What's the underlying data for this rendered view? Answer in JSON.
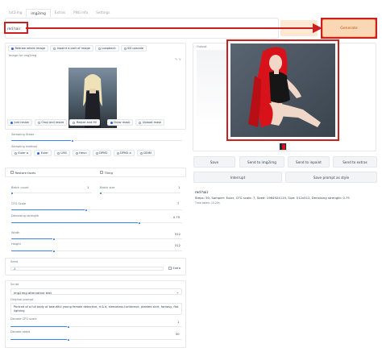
{
  "tabs": [
    "txt2img",
    "img2img",
    "Extras",
    "PNG Info",
    "Settings"
  ],
  "prompt": {
    "value": "red hair"
  },
  "generate_label": "Generate",
  "mode_tabs": [
    "Redraw whole image",
    "Inpaint a part of image",
    "Loopback",
    "SD upscale"
  ],
  "image_panel_label": "Image for img2img",
  "output_label": "Output",
  "resize_options": [
    "Just resize",
    "Crop and resize",
    "Resize and fill"
  ],
  "mask_options": [
    "Draw mask",
    "Upload mask"
  ],
  "sampling_steps": {
    "label": "Sampling Steps",
    "fraction": 0.36
  },
  "sampling_method": {
    "label": "Sampling method",
    "options": [
      "Euler a",
      "Euler",
      "LMS",
      "Heun",
      "DPM2",
      "DPM2 a",
      "DDIM"
    ],
    "selected": "Euler"
  },
  "restore_faces": "Restore faces",
  "tiling": "Tiling",
  "batch_count": {
    "label": "Batch count",
    "value": "1"
  },
  "batch_size": {
    "label": "Batch size",
    "value": "1"
  },
  "cfg_scale": {
    "label": "CFG Scale",
    "value": "7",
    "fraction": 0.44
  },
  "denoising": {
    "label": "Denoising strength",
    "value": "0.75",
    "fraction": 0.75
  },
  "width": {
    "label": "Width",
    "value": "512",
    "fraction": 0.25
  },
  "height": {
    "label": "Height",
    "value": "512",
    "fraction": 0.25
  },
  "seed": {
    "label": "Seed",
    "value": "-1"
  },
  "extra_label": "Extra",
  "script": {
    "label": "Script",
    "value": "img2img alternative test"
  },
  "original_prompt": {
    "label": "Original prompt",
    "value": "Portrait of a full body of beautiful young female detective, d & d, sleeveless turtleneck, pleated skirt, fantasy, flat lighting"
  },
  "decode_cfg": {
    "label": "Decode CFG scale",
    "value": "1",
    "fraction": 0.34
  },
  "decode_steps": {
    "label": "Decode steps",
    "value": "50",
    "fraction": 0.34
  },
  "actions": {
    "save": "Save",
    "send_img2img": "Send to img2img",
    "send_inpaint": "Send to inpaint",
    "send_extras": "Send to extras",
    "interrupt": "Interrupt",
    "save_style": "Save prompt as style"
  },
  "result": {
    "title": "red hair",
    "params": "Steps: 50, Sampler: Euler, CFG scale: 7, Seed: 1964924119, Size: 512x512, Denoising strength: 0.75",
    "time": "Time taken: 10.20s"
  },
  "colors": {
    "accent": "#2563eb",
    "generate_bg": "#fbd8b5",
    "annotation_red": "#cc2020"
  }
}
